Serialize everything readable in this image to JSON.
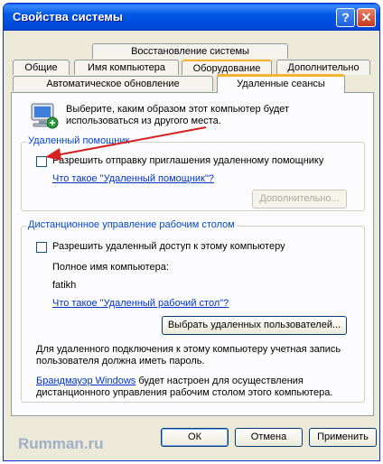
{
  "window": {
    "title": "Свойства системы"
  },
  "titlebar": {
    "help_label": "?",
    "close_label": "✕"
  },
  "tabs": {
    "row1": [
      "Восстановление системы"
    ],
    "row2": [
      "Общие",
      "Имя компьютера",
      "Оборудование",
      "Дополнительно"
    ],
    "row3": [
      "Автоматическое обновление",
      "Удаленные сеансы"
    ]
  },
  "intro": {
    "text_line1": "Выберите, каким образом этот компьютер будет",
    "text_line2": "использоваться из другого места."
  },
  "assistance": {
    "group_label": "Удаленный помощник",
    "checkbox_label": "Разрешить отправку приглашения удаленному помощнику",
    "checkbox_checked": false,
    "link": "Что такое \"Удаленный помощник\"?",
    "advanced_button": "Дополнительно..."
  },
  "desktop": {
    "group_label": "Дистанционное управление рабочим столом",
    "checkbox_label": "Разрешить удаленный доступ к этому компьютеру",
    "checkbox_checked": false,
    "computer_name_label": "Полное имя компьютера:",
    "computer_name": "fatikh",
    "link": "Что такое \"Удаленный рабочий стол\"?",
    "select_users_button": "Выбрать удаленных пользователей...",
    "note_line1": "Для удаленного подключения к этому компьютеру учетная запись",
    "note_line2": "пользователя должна иметь пароль.",
    "firewall_link": "Брандмауэр Windows",
    "firewall_line1_rest": " будет настроен для осуществления",
    "firewall_line2": "дистанционного управления рабочим столом этого компьютера."
  },
  "footer": {
    "ok": "ОК",
    "cancel": "Отмена",
    "apply": "Применить"
  },
  "watermark": "Rumman.ru",
  "colors": {
    "annotation": "#d42222",
    "link": "#0033cc",
    "titlebar": "#0058e6"
  }
}
